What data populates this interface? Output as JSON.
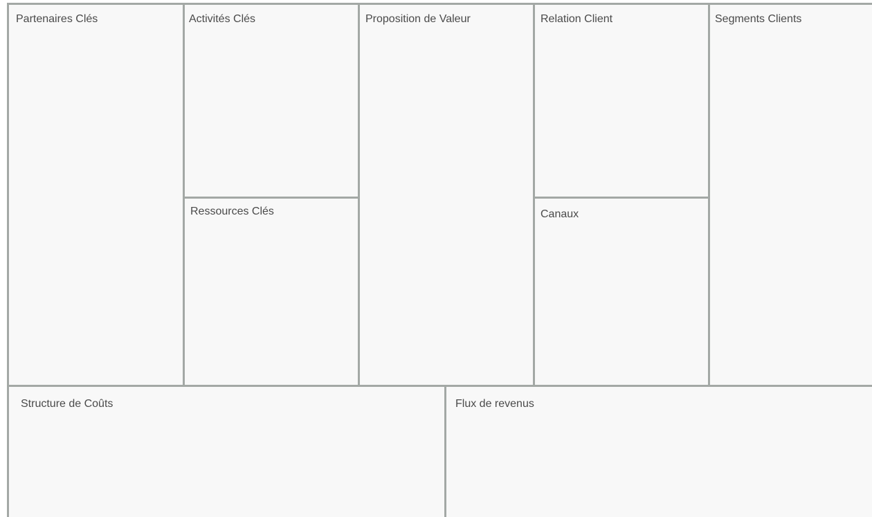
{
  "canvas": {
    "border_color": "#a3a8a5",
    "cell_background": "#f8f8f8",
    "text_color": "#4a4a4a",
    "blocks": {
      "key_partners": "Partenaires Clés",
      "key_activities": "Activités Clés",
      "key_resources": "Ressources Clés",
      "value_proposition": "Proposition de Valeur",
      "customer_relationship": "Relation Client",
      "channels": "Canaux",
      "customer_segments": "Segments Clients",
      "cost_structure": "Structure de Coûts",
      "revenue_streams": "Flux de revenus"
    }
  }
}
